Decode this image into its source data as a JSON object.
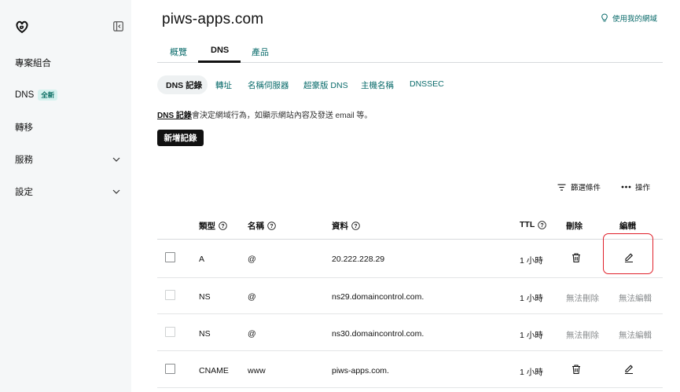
{
  "sidebar": {
    "items": [
      {
        "label": "專案組合"
      },
      {
        "label": "DNS",
        "badge": "全新"
      },
      {
        "label": "轉移"
      },
      {
        "label": "服務"
      },
      {
        "label": "設定"
      }
    ]
  },
  "header": {
    "domain": "piws-apps.com",
    "help_link": "使用我的網域"
  },
  "tabs": [
    {
      "label": "概覽"
    },
    {
      "label": "DNS"
    },
    {
      "label": "產品"
    }
  ],
  "subtabs": [
    {
      "label": "DNS 記錄"
    },
    {
      "label": "轉址"
    },
    {
      "label": "名稱伺服器"
    },
    {
      "label": "超豪版 DNS"
    },
    {
      "label": "主機名稱"
    },
    {
      "label": "DNSSEC"
    }
  ],
  "description": {
    "link": "DNS 記錄",
    "text": "會決定網域行為，如顯示網站內容及發送 email 等。"
  },
  "actions": {
    "add_record": "新增記錄",
    "filter": "篩選條件",
    "operations": "操作"
  },
  "table": {
    "headers": {
      "type": "類型",
      "name": "名稱",
      "data": "資料",
      "ttl": "TTL",
      "delete": "刪除",
      "edit": "編輯"
    },
    "rows": [
      {
        "type": "A",
        "name": "@",
        "data": "20.222.228.29",
        "ttl": "1 小時",
        "editable": true
      },
      {
        "type": "NS",
        "name": "@",
        "data": "ns29.domaincontrol.com.",
        "ttl": "1 小時",
        "editable": false,
        "delete_text": "無法刪除",
        "edit_text": "無法編輯"
      },
      {
        "type": "NS",
        "name": "@",
        "data": "ns30.domaincontrol.com.",
        "ttl": "1 小時",
        "editable": false,
        "delete_text": "無法刪除",
        "edit_text": "無法編輯"
      },
      {
        "type": "CNAME",
        "name": "www",
        "data": "piws-apps.com.",
        "ttl": "1 小時",
        "editable": true
      }
    ]
  },
  "colors": {
    "accent": "#0a6b6b",
    "highlight": "#e0202a",
    "sidebar_bg": "#f5f7f8"
  }
}
